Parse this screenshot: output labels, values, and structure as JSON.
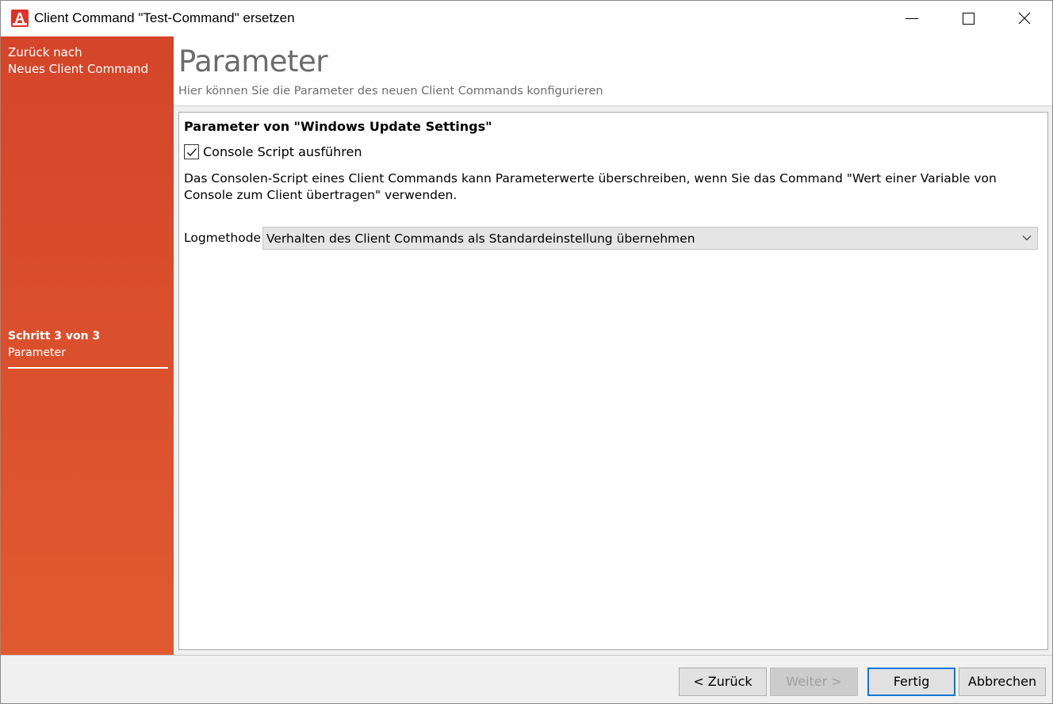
{
  "window": {
    "title": "Client Command \"Test-Command\" ersetzen",
    "app_icon_letter": "A",
    "controls": [
      "minimize-icon",
      "maximize-icon",
      "close-icon"
    ]
  },
  "sidebar": {
    "back_line1": "Zurück nach",
    "back_line2": "Neues Client Command",
    "step_title": "Schritt 3 von 3",
    "step_name": "Parameter",
    "color": "#d94e2d"
  },
  "header": {
    "title": "Parameter",
    "subtitle": "Hier können Sie die Parameter des neuen Client Commands konfigurieren"
  },
  "panel": {
    "heading": "Parameter von \"Windows Update Settings\"",
    "checkbox_label": "Console Script ausführen",
    "checkbox_checked": true,
    "description": "Das Consolen-Script eines Client Commands kann Parameterwerte überschreiben, wenn Sie das Command \"Wert einer Variable von Console zum Client übertragen\" verwenden.",
    "logmethod_label": "Logmethode",
    "logmethod_value": "Verhalten des Client Commands als Standardeinstellung übernehmen"
  },
  "footer": {
    "back_label": "< Zurück",
    "next_label": "Weiter >",
    "finish_label": "Fertig",
    "cancel_label": "Abbrechen",
    "accent": "#0078d7"
  }
}
